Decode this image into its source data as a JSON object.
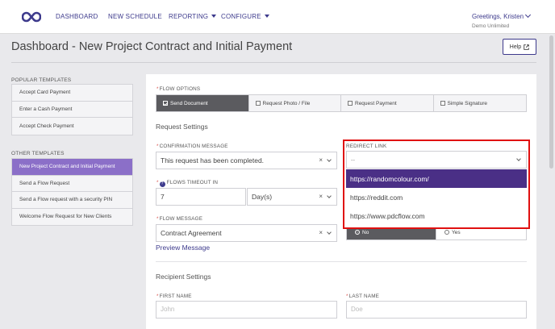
{
  "nav": {
    "items": [
      {
        "label": "DASHBOARD"
      },
      {
        "label": "NEW SCHEDULE"
      },
      {
        "label": "REPORTING"
      },
      {
        "label": "CONFIGURE"
      }
    ],
    "greeting": "Greetings, Kristen",
    "org": "Demo Unlimited"
  },
  "page": {
    "title": "Dashboard - New Project Contract and Initial Payment",
    "help": "Help"
  },
  "sidebar": {
    "popular_heading": "POPULAR TEMPLATES",
    "popular": [
      "Accept Card Payment",
      "Enter a Cash Payment",
      "Accept Check Payment"
    ],
    "other_heading": "OTHER TEMPLATES",
    "other": [
      "New Project Contract and Initial Payment",
      "Send a Flow Request",
      "Send a Flow request with a security PIN",
      "Welcome Flow Request for New Clients"
    ],
    "active_index": 0
  },
  "form": {
    "flow_options_label": "FLOW OPTIONS",
    "flow_options": [
      "Send Document",
      "Request Photo / File",
      "Request Payment",
      "Simple Signature"
    ],
    "flow_options_selected": "Send Document",
    "request_settings_heading": "Request Settings",
    "confirmation_label": "CONFIRMATION MESSAGE",
    "confirmation_value": "This request has been completed.",
    "redirect_label": "REDIRECT LINK",
    "redirect_value": "--",
    "redirect_options": [
      "https://randomcolour.com/",
      "https://reddit.com",
      "https://www.pdcflow.com"
    ],
    "redirect_highlighted": "https://randomcolour.com/",
    "timeout_label": "FLOWS TIMEOUT IN",
    "timeout_value": "7",
    "timeout_unit": "Day(s)",
    "message_label": "FLOW MESSAGE",
    "message_value": "Contract Agreement",
    "toggle_no": "No",
    "toggle_yes": "Yes",
    "preview_link": "Preview Message",
    "recipient_heading": "Recipient Settings",
    "first_name_label": "FIRST NAME",
    "first_name_placeholder": "John",
    "last_name_label": "LAST NAME",
    "last_name_placeholder": "Doe"
  },
  "colors": {
    "brand": "#3d3a8c",
    "sidebar_active": "#8b6fc8",
    "highlight_option": "#4a2f86",
    "annotation_box": "#e01010"
  }
}
